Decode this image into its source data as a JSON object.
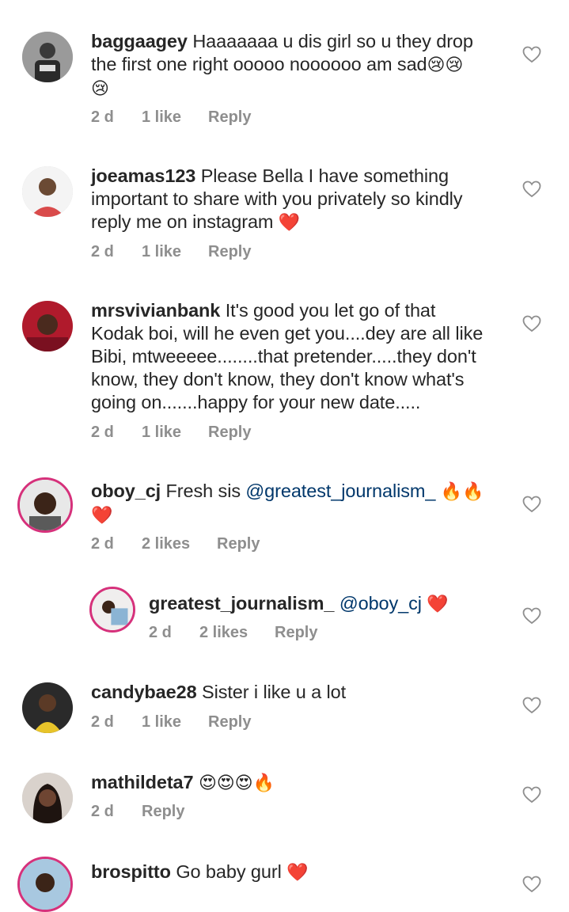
{
  "comments": [
    {
      "username": "baggaagey",
      "text_line1": "Haaaaaaa u dis girl so u they drop",
      "text_line2": "the first one right ooooo noooooo am sad",
      "emoji_line2": "😢😢",
      "emoji_line3": "😢",
      "time": "2 d",
      "likes": "1 like",
      "reply": "Reply"
    },
    {
      "username": "joeamas123",
      "text_line1": "Please Bella I have something",
      "text_line2": "important to share with you privately so kindly",
      "text_line3": "reply me on instagram",
      "emoji": "❤️",
      "time": "2 d",
      "likes": "1 like",
      "reply": "Reply"
    },
    {
      "username": "mrsvivianbank",
      "text_line1": "It's good you let go of that",
      "text_line2": "Kodak boi, will he even get you....dey are all like",
      "text_line3": "Bibi, mtweeeee........that pretender.....they don't",
      "text_line4": "know, they don't know, they don't know what's",
      "text_line5": "going on.......happy for your new date.....",
      "time": "2 d",
      "likes": "1 like",
      "reply": "Reply"
    },
    {
      "username": "oboy_cj",
      "text": "Fresh sis",
      "mention": "@greatest_journalism_",
      "emoji_line1": "🔥🔥",
      "emoji_line2": "❤️",
      "time": "2 d",
      "likes": "2 likes",
      "reply": "Reply"
    },
    {
      "username": "greatest_journalism_",
      "mention": "@oboy_cj",
      "emoji": "❤️",
      "time": "2 d",
      "likes": "2 likes",
      "reply": "Reply"
    },
    {
      "username": "candybae28",
      "text": "Sister i like u a lot",
      "time": "2 d",
      "likes": "1 like",
      "reply": "Reply"
    },
    {
      "username": "mathildeta7",
      "emoji": "😍😍😍🔥",
      "time": "2 d",
      "reply": "Reply"
    },
    {
      "username": "brospitto",
      "text": "Go baby gurl",
      "emoji": "❤️"
    }
  ],
  "colors": {
    "text": "#262626",
    "meta": "#8e8e8e",
    "mention": "#00376b",
    "story_ring": "#d6317b"
  }
}
